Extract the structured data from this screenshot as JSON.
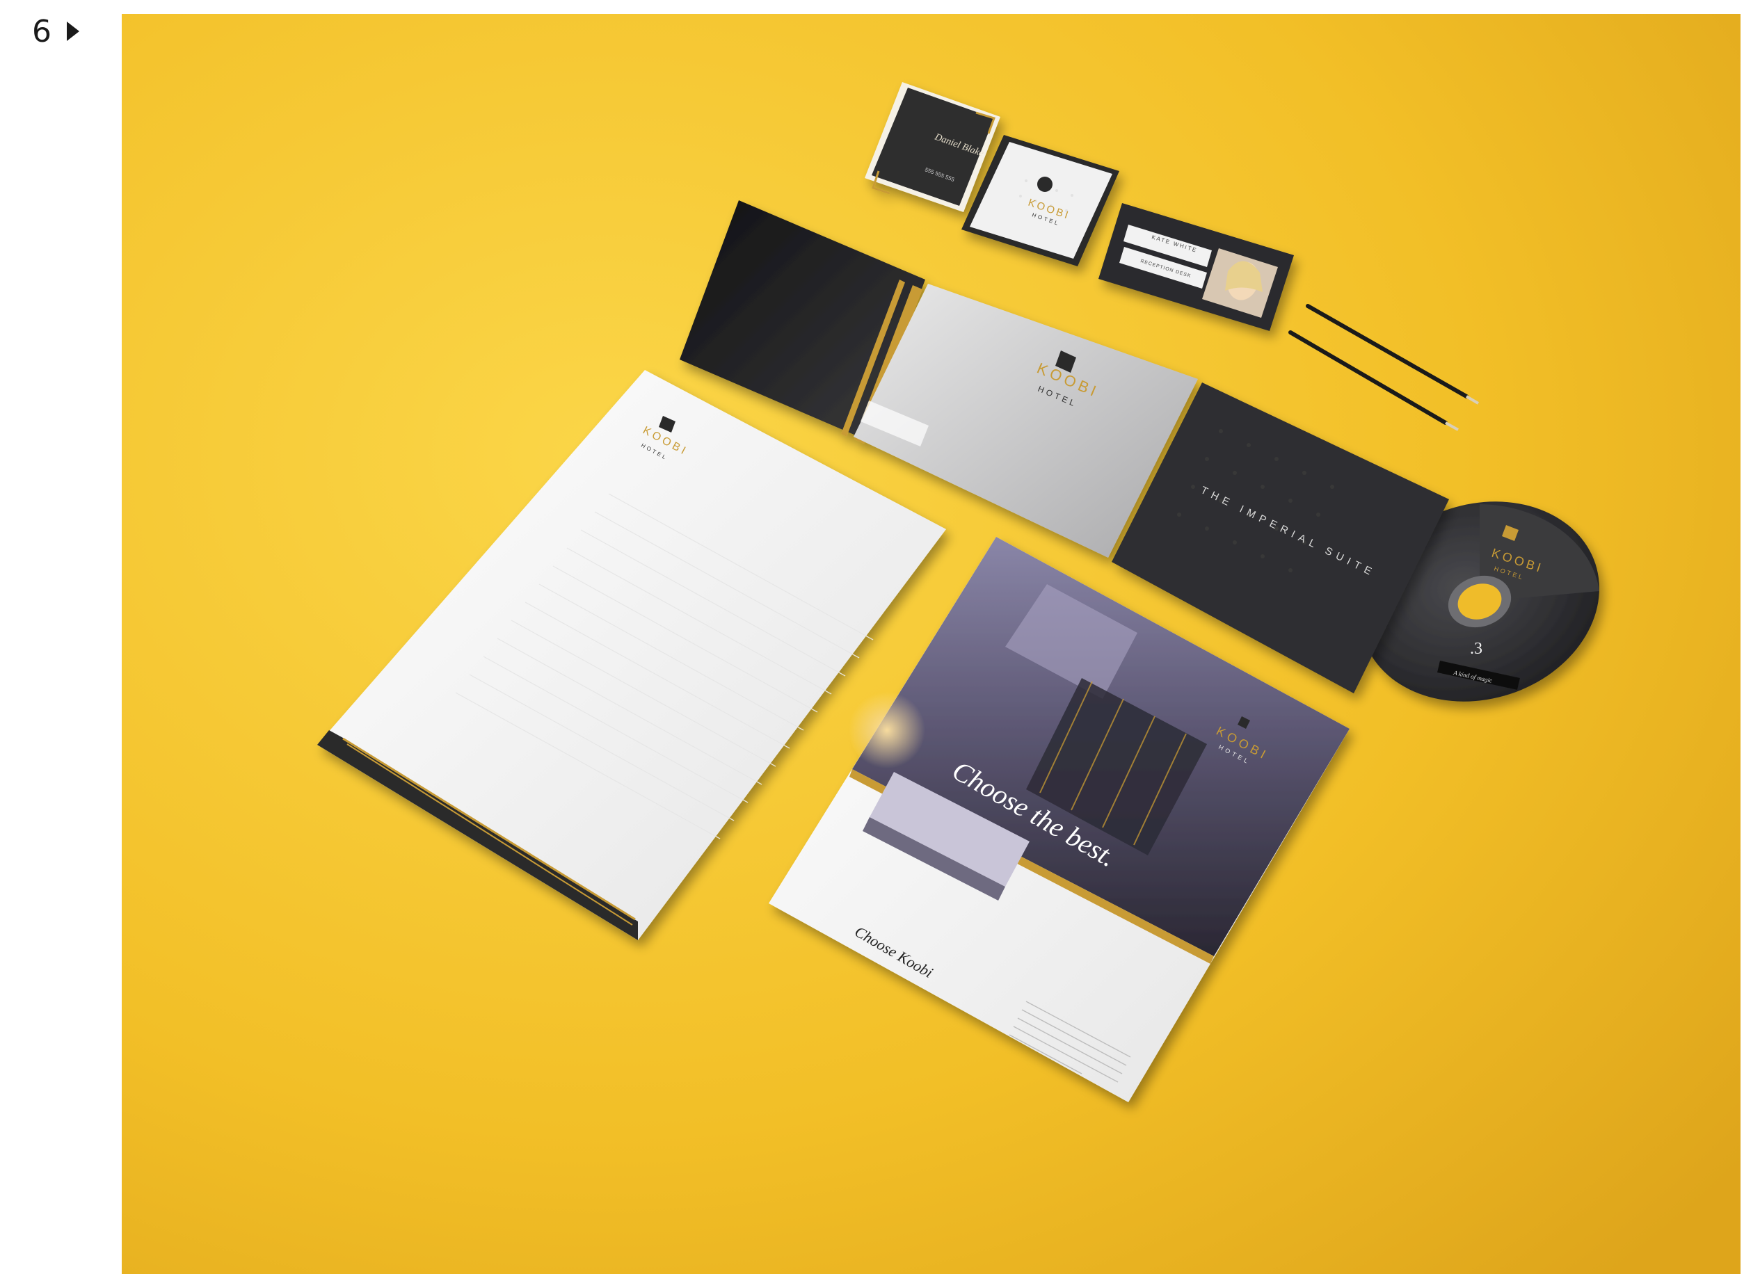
{
  "slide": {
    "number": "6"
  },
  "icons": {
    "next": "play-triangle-icon"
  },
  "colors": {
    "background": "#f7c62b",
    "dark": "#2a2a2c",
    "gold": "#c89b34",
    "paper": "#f4f4f4"
  },
  "mockup": {
    "business_card_front": {
      "name": "Daniel Blake",
      "phone": "555 555 555"
    },
    "business_card_back": {
      "brand": "KOOBI",
      "sub": "HOTEL"
    },
    "keycard": {
      "name": "KATE WHITE",
      "title": "RECEPTION DESK"
    },
    "folder": {
      "brand": "KOOBI",
      "sub": "HOTEL"
    },
    "letterhead": {
      "brand": "KOOBI",
      "sub": "HOTEL"
    },
    "cd_sleeve": {
      "text": "THE IMPERIAL SUITE"
    },
    "cd": {
      "brand": "KOOBI",
      "sub": "HOTEL",
      "number": ".3",
      "caption": "A kind of magic"
    },
    "brochure": {
      "brand": "KOOBI",
      "sub": "HOTEL",
      "headline": "Choose the best.",
      "tagline": "Choose Koobi"
    }
  }
}
